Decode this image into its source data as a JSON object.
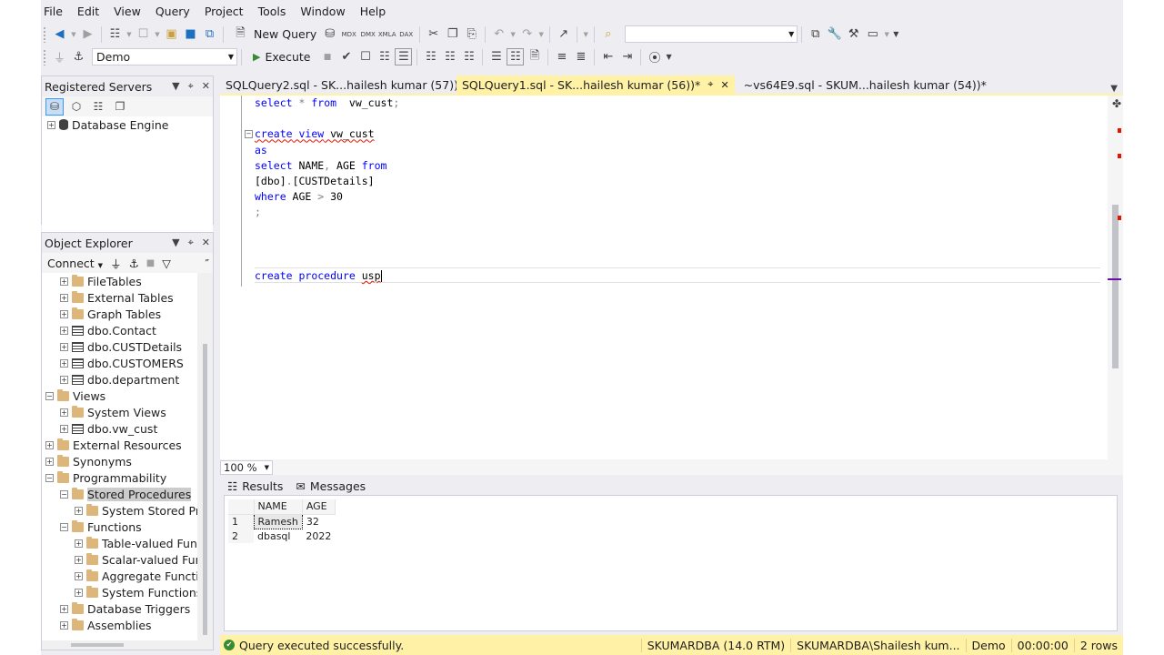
{
  "menu": [
    "File",
    "Edit",
    "View",
    "Query",
    "Project",
    "Tools",
    "Window",
    "Help"
  ],
  "toolbar1": {
    "new_query_label": "New Query",
    "file_type_icons": [
      "MDX",
      "DMX",
      "XMLA",
      "DAX"
    ],
    "search_value": ""
  },
  "toolbar2": {
    "database": "Demo",
    "execute_label": "Execute"
  },
  "registered_servers": {
    "title": "Registered Servers",
    "items": [
      "Database Engine"
    ]
  },
  "object_explorer": {
    "title": "Object Explorer",
    "connect_label": "Connect",
    "nodes": [
      {
        "label": "FileTables",
        "indent": 1,
        "icon": "folder",
        "toggle": "+"
      },
      {
        "label": "External Tables",
        "indent": 1,
        "icon": "folder",
        "toggle": "+"
      },
      {
        "label": "Graph Tables",
        "indent": 1,
        "icon": "folder",
        "toggle": "+"
      },
      {
        "label": "dbo.Contact",
        "indent": 1,
        "icon": "table",
        "toggle": "+"
      },
      {
        "label": "dbo.CUSTDetails",
        "indent": 1,
        "icon": "table",
        "toggle": "+"
      },
      {
        "label": "dbo.CUSTOMERS",
        "indent": 1,
        "icon": "table",
        "toggle": "+"
      },
      {
        "label": "dbo.department",
        "indent": 1,
        "icon": "table",
        "toggle": "+"
      },
      {
        "label": "Views",
        "indent": 0,
        "icon": "folder",
        "toggle": "-"
      },
      {
        "label": "System Views",
        "indent": 1,
        "icon": "folder",
        "toggle": "+"
      },
      {
        "label": "dbo.vw_cust",
        "indent": 1,
        "icon": "table",
        "toggle": "+"
      },
      {
        "label": "External Resources",
        "indent": 0,
        "icon": "folder",
        "toggle": "+"
      },
      {
        "label": "Synonyms",
        "indent": 0,
        "icon": "folder",
        "toggle": "+"
      },
      {
        "label": "Programmability",
        "indent": 0,
        "icon": "folder",
        "toggle": "-"
      },
      {
        "label": "Stored Procedures",
        "indent": 1,
        "icon": "folder",
        "toggle": "-",
        "selected": true
      },
      {
        "label": "System Stored Proce",
        "indent": 2,
        "icon": "folder",
        "toggle": "+"
      },
      {
        "label": "Functions",
        "indent": 1,
        "icon": "folder",
        "toggle": "-"
      },
      {
        "label": "Table-valued Functi",
        "indent": 2,
        "icon": "folder",
        "toggle": "+"
      },
      {
        "label": "Scalar-valued Funct",
        "indent": 2,
        "icon": "folder",
        "toggle": "+"
      },
      {
        "label": "Aggregate Function",
        "indent": 2,
        "icon": "folder",
        "toggle": "+"
      },
      {
        "label": "System Functions",
        "indent": 2,
        "icon": "folder",
        "toggle": "+"
      },
      {
        "label": "Database Triggers",
        "indent": 1,
        "icon": "folder",
        "toggle": "+"
      },
      {
        "label": "Assemblies",
        "indent": 1,
        "icon": "folder",
        "toggle": "+"
      }
    ]
  },
  "tabs": [
    {
      "label": "SQLQuery2.sql - SK...hailesh kumar (57))",
      "active": false
    },
    {
      "label": "SQLQuery1.sql - SK...hailesh kumar (56))*",
      "active": true
    },
    {
      "label": "~vs64E9.sql - SKUM...hailesh kumar (54))*",
      "active": false
    }
  ],
  "editor": {
    "zoom": "100 %",
    "lines": [
      [
        {
          "t": "select",
          "c": "kw"
        },
        {
          "t": " ",
          "c": ""
        },
        {
          "t": "*",
          "c": "gray"
        },
        {
          "t": " ",
          "c": ""
        },
        {
          "t": "from",
          "c": "kw"
        },
        {
          "t": "  vw_cust",
          "c": ""
        },
        {
          "t": ";",
          "c": "gray"
        }
      ],
      [],
      [
        {
          "t": "create",
          "c": "kw sq"
        },
        {
          "t": " ",
          "c": "sq"
        },
        {
          "t": "view",
          "c": "kw sq"
        },
        {
          "t": " vw_cust",
          "c": "sq"
        }
      ],
      [
        {
          "t": "as",
          "c": "kw"
        }
      ],
      [
        {
          "t": "select",
          "c": "kw"
        },
        {
          "t": " NAME",
          "c": ""
        },
        {
          "t": ",",
          "c": "gray"
        },
        {
          "t": " AGE ",
          "c": ""
        },
        {
          "t": "from",
          "c": "kw"
        }
      ],
      [
        {
          "t": "[dbo]",
          "c": ""
        },
        {
          "t": ".",
          "c": "gray"
        },
        {
          "t": "[CUSTDetails]",
          "c": ""
        }
      ],
      [
        {
          "t": "where",
          "c": "kw"
        },
        {
          "t": " AGE ",
          "c": ""
        },
        {
          "t": ">",
          "c": "gray"
        },
        {
          "t": " 30",
          "c": ""
        }
      ],
      [
        {
          "t": ";",
          "c": "gray"
        }
      ],
      [],
      [],
      [],
      [
        {
          "t": "create",
          "c": "kw"
        },
        {
          "t": " ",
          "c": ""
        },
        {
          "t": "procedure",
          "c": "kw"
        },
        {
          "t": " ",
          "c": ""
        },
        {
          "t": "usp",
          "c": "sq"
        }
      ]
    ]
  },
  "results": {
    "tab_results": "Results",
    "tab_messages": "Messages",
    "columns": [
      "NAME",
      "AGE"
    ],
    "rows": [
      {
        "n": "1",
        "cells": [
          "Ramesh",
          "32"
        ]
      },
      {
        "n": "2",
        "cells": [
          "dbasql",
          "2022"
        ]
      }
    ]
  },
  "status": {
    "message": "Query executed successfully.",
    "server": "SKUMARDBA (14.0 RTM)",
    "user": "SKUMARDBA\\Shailesh kum...",
    "database": "Demo",
    "time": "00:00:00",
    "rows": "2 rows"
  },
  "colors": {
    "accent_tab": "#fff2a6",
    "keyword": "#0000ff",
    "success": "#388a34"
  }
}
